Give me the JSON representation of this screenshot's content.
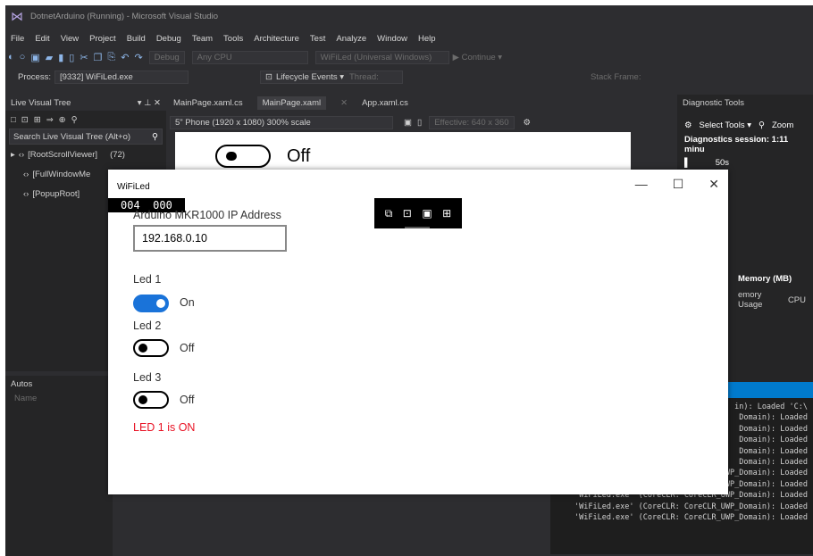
{
  "vs": {
    "title": "DotnetArduino (Running) - Microsoft Visual Studio",
    "menu": [
      "File",
      "Edit",
      "View",
      "Project",
      "Build",
      "Debug",
      "Team",
      "Tools",
      "Architecture",
      "Test",
      "Analyze",
      "Window",
      "Help"
    ],
    "toolbar": {
      "debug_box": "Debug",
      "platform_box": "Any CPU",
      "target_box": "WiFiLed (Universal Windows)",
      "continue": "▶ Continue ▾"
    },
    "process": {
      "label": "Process:",
      "value": "[9332] WiFiLed.exe",
      "lifecycle": "Lifecycle Events ▾",
      "thread": "Thread:",
      "stack": "Stack Frame:"
    },
    "live_tree": {
      "title": "Live Visual Tree",
      "search_placeholder": "Search Live Visual Tree (Alt+o)",
      "rows": [
        {
          "label": "[RootScrollViewer]",
          "count": "(72)"
        },
        {
          "label": "[FullWindowMe",
          "count": ""
        },
        {
          "label": "[PopupRoot]",
          "count": ""
        }
      ]
    },
    "autos": {
      "title": "Autos",
      "col": "Name"
    },
    "designer": {
      "tabs": [
        "MainPage.xaml.cs",
        "MainPage.xaml",
        "App.xaml.cs"
      ],
      "device": "5\" Phone (1920 x 1080) 300% scale",
      "effective": "Effective: 640 x 360",
      "canvas_toggle_text": "Off"
    },
    "diagnostics": {
      "title": "Diagnostic Tools",
      "select_tools": "Select Tools ▾",
      "zoom": "Zoom",
      "session": "Diagnostics session: 1:11 minu",
      "time": "50s",
      "memory_title": "Memory (MB)",
      "memory_usage": "emory Usage",
      "cpu": "CPU"
    },
    "output_lines": [
      "in): Loaded 'C:\\",
      "Domain): Loaded",
      "Domain): Loaded",
      "Domain): Loaded",
      "Domain): Loaded",
      "Domain): Loaded",
      "'WiFiLed.exe' (CoreCLR: CoreCLR_UWP_Domain): Loaded",
      "'WiFiLed.exe' (CoreCLR: CoreCLR_UWP_Domain): Loaded",
      "'WiFiLed.exe' (CoreCLR: CoreCLR_UWP_Domain): Loaded",
      "'WiFiLed.exe' (CoreCLR: CoreCLR_UWP_Domain): Loaded",
      "'WiFiLed.exe' (CoreCLR: CoreCLR_UWP_Domain): Loaded"
    ]
  },
  "app": {
    "title": "WiFiLed",
    "counter": "004  000",
    "ip_label": "Arduino MKR1000 IP Address",
    "ip_value": "192.168.0.10",
    "leds": [
      {
        "label": "Led 1",
        "state_text": "On",
        "on": true
      },
      {
        "label": "Led 2",
        "state_text": "Off",
        "on": false
      },
      {
        "label": "Led 3",
        "state_text": "Off",
        "on": false
      }
    ],
    "status": "LED 1 is ON",
    "status_color": "#e81123",
    "accent": "#1a73d9"
  }
}
